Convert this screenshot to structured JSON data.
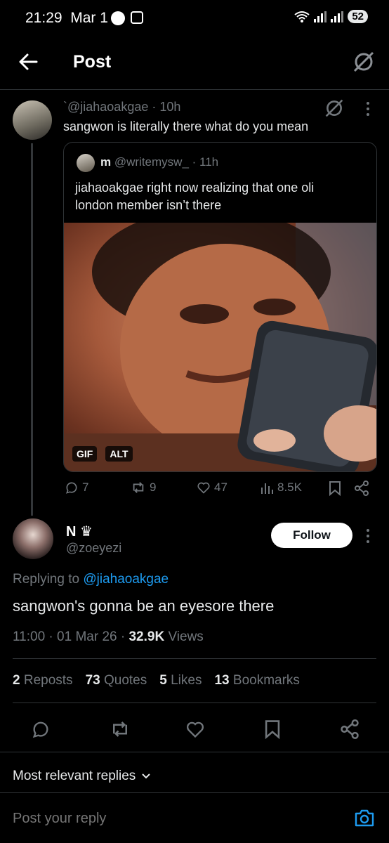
{
  "status_bar": {
    "time": "21:29",
    "date": "Mar 1",
    "battery": "52"
  },
  "header": {
    "title": "Post"
  },
  "parent_post": {
    "handle": "`@jiahaoakgae",
    "time": "· 10h",
    "text": "sangwon is literally there what do you mean",
    "quote": {
      "name": "m",
      "handle": "@writemysw_",
      "time": "· 11h",
      "text_line1": "jiahaoakgae right now realizing that one oli",
      "text_line2": "london member isn’t there",
      "badges": [
        "GIF",
        "ALT"
      ]
    },
    "actions": {
      "replies": "7",
      "reposts": "9",
      "likes": "47",
      "views": "8.5K"
    }
  },
  "main_post": {
    "name": "N",
    "name_emoji": "♛",
    "handle": "@zoeyezi",
    "follow_label": "Follow",
    "replying_prefix": "Replying to",
    "replying_handle": "@jiahaoakgae",
    "text": "sangwon's gonna be an eyesore there",
    "time": "11:00",
    "date": "01 Mar 26",
    "views_count": "32.9K",
    "views_label": "Views",
    "stats": [
      {
        "num": "2",
        "label": "Reposts"
      },
      {
        "num": "73",
        "label": "Quotes"
      },
      {
        "num": "5",
        "label": "Likes"
      },
      {
        "num": "13",
        "label": "Bookmarks"
      }
    ]
  },
  "replies_sort": "Most relevant replies",
  "reply_input": {
    "placeholder": "Post your reply"
  },
  "colors": {
    "accent": "#1d9bf0",
    "background": "#000000",
    "muted": "#71767b",
    "divider": "#2f3336"
  }
}
